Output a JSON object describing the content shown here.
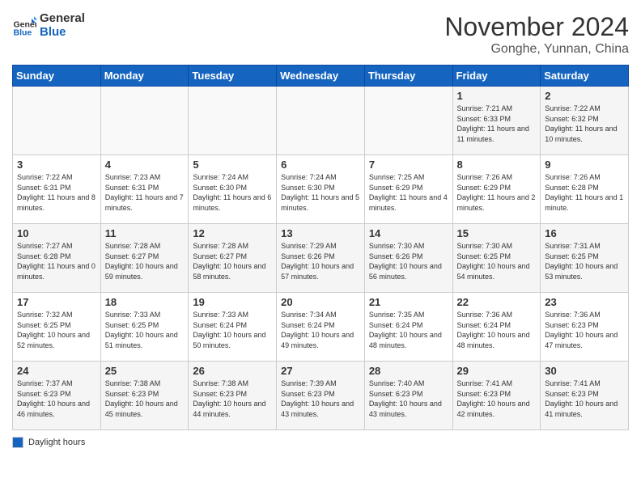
{
  "logo": {
    "line1": "General",
    "line2": "Blue"
  },
  "title": "November 2024",
  "subtitle": "Gonghe, Yunnan, China",
  "headers": [
    "Sunday",
    "Monday",
    "Tuesday",
    "Wednesday",
    "Thursday",
    "Friday",
    "Saturday"
  ],
  "weeks": [
    [
      {
        "day": "",
        "info": ""
      },
      {
        "day": "",
        "info": ""
      },
      {
        "day": "",
        "info": ""
      },
      {
        "day": "",
        "info": ""
      },
      {
        "day": "",
        "info": ""
      },
      {
        "day": "1",
        "info": "Sunrise: 7:21 AM\nSunset: 6:33 PM\nDaylight: 11 hours and 11 minutes."
      },
      {
        "day": "2",
        "info": "Sunrise: 7:22 AM\nSunset: 6:32 PM\nDaylight: 11 hours and 10 minutes."
      }
    ],
    [
      {
        "day": "3",
        "info": "Sunrise: 7:22 AM\nSunset: 6:31 PM\nDaylight: 11 hours and 8 minutes."
      },
      {
        "day": "4",
        "info": "Sunrise: 7:23 AM\nSunset: 6:31 PM\nDaylight: 11 hours and 7 minutes."
      },
      {
        "day": "5",
        "info": "Sunrise: 7:24 AM\nSunset: 6:30 PM\nDaylight: 11 hours and 6 minutes."
      },
      {
        "day": "6",
        "info": "Sunrise: 7:24 AM\nSunset: 6:30 PM\nDaylight: 11 hours and 5 minutes."
      },
      {
        "day": "7",
        "info": "Sunrise: 7:25 AM\nSunset: 6:29 PM\nDaylight: 11 hours and 4 minutes."
      },
      {
        "day": "8",
        "info": "Sunrise: 7:26 AM\nSunset: 6:29 PM\nDaylight: 11 hours and 2 minutes."
      },
      {
        "day": "9",
        "info": "Sunrise: 7:26 AM\nSunset: 6:28 PM\nDaylight: 11 hours and 1 minute."
      }
    ],
    [
      {
        "day": "10",
        "info": "Sunrise: 7:27 AM\nSunset: 6:28 PM\nDaylight: 11 hours and 0 minutes."
      },
      {
        "day": "11",
        "info": "Sunrise: 7:28 AM\nSunset: 6:27 PM\nDaylight: 10 hours and 59 minutes."
      },
      {
        "day": "12",
        "info": "Sunrise: 7:28 AM\nSunset: 6:27 PM\nDaylight: 10 hours and 58 minutes."
      },
      {
        "day": "13",
        "info": "Sunrise: 7:29 AM\nSunset: 6:26 PM\nDaylight: 10 hours and 57 minutes."
      },
      {
        "day": "14",
        "info": "Sunrise: 7:30 AM\nSunset: 6:26 PM\nDaylight: 10 hours and 56 minutes."
      },
      {
        "day": "15",
        "info": "Sunrise: 7:30 AM\nSunset: 6:25 PM\nDaylight: 10 hours and 54 minutes."
      },
      {
        "day": "16",
        "info": "Sunrise: 7:31 AM\nSunset: 6:25 PM\nDaylight: 10 hours and 53 minutes."
      }
    ],
    [
      {
        "day": "17",
        "info": "Sunrise: 7:32 AM\nSunset: 6:25 PM\nDaylight: 10 hours and 52 minutes."
      },
      {
        "day": "18",
        "info": "Sunrise: 7:33 AM\nSunset: 6:25 PM\nDaylight: 10 hours and 51 minutes."
      },
      {
        "day": "19",
        "info": "Sunrise: 7:33 AM\nSunset: 6:24 PM\nDaylight: 10 hours and 50 minutes."
      },
      {
        "day": "20",
        "info": "Sunrise: 7:34 AM\nSunset: 6:24 PM\nDaylight: 10 hours and 49 minutes."
      },
      {
        "day": "21",
        "info": "Sunrise: 7:35 AM\nSunset: 6:24 PM\nDaylight: 10 hours and 48 minutes."
      },
      {
        "day": "22",
        "info": "Sunrise: 7:36 AM\nSunset: 6:24 PM\nDaylight: 10 hours and 48 minutes."
      },
      {
        "day": "23",
        "info": "Sunrise: 7:36 AM\nSunset: 6:23 PM\nDaylight: 10 hours and 47 minutes."
      }
    ],
    [
      {
        "day": "24",
        "info": "Sunrise: 7:37 AM\nSunset: 6:23 PM\nDaylight: 10 hours and 46 minutes."
      },
      {
        "day": "25",
        "info": "Sunrise: 7:38 AM\nSunset: 6:23 PM\nDaylight: 10 hours and 45 minutes."
      },
      {
        "day": "26",
        "info": "Sunrise: 7:38 AM\nSunset: 6:23 PM\nDaylight: 10 hours and 44 minutes."
      },
      {
        "day": "27",
        "info": "Sunrise: 7:39 AM\nSunset: 6:23 PM\nDaylight: 10 hours and 43 minutes."
      },
      {
        "day": "28",
        "info": "Sunrise: 7:40 AM\nSunset: 6:23 PM\nDaylight: 10 hours and 43 minutes."
      },
      {
        "day": "29",
        "info": "Sunrise: 7:41 AM\nSunset: 6:23 PM\nDaylight: 10 hours and 42 minutes."
      },
      {
        "day": "30",
        "info": "Sunrise: 7:41 AM\nSunset: 6:23 PM\nDaylight: 10 hours and 41 minutes."
      }
    ]
  ],
  "legend": {
    "label": "Daylight hours"
  }
}
